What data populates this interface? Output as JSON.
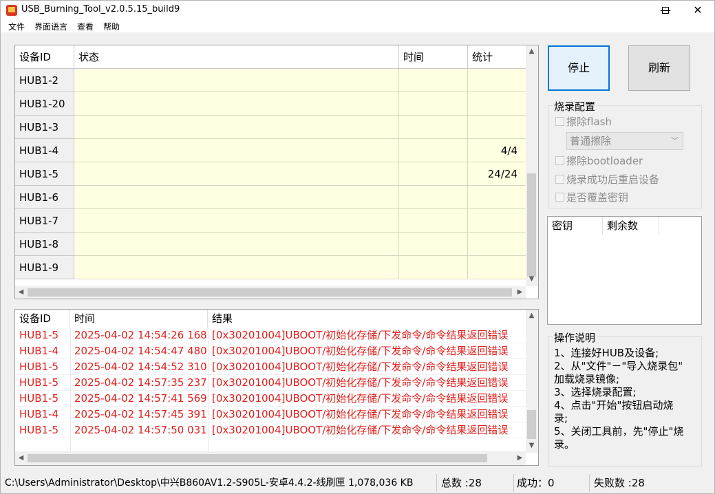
{
  "window": {
    "title": "USB_Burning_Tool_v2.0.5.15_build9"
  },
  "menu": [
    "文件",
    "界面语言",
    "查看",
    "帮助"
  ],
  "grid": {
    "headers": [
      "设备ID",
      "状态",
      "时间",
      "统计"
    ],
    "rows": [
      {
        "id": "HUB1-2",
        "status": "",
        "time": "",
        "stat": ""
      },
      {
        "id": "HUB1-20",
        "status": "",
        "time": "",
        "stat": ""
      },
      {
        "id": "HUB1-3",
        "status": "",
        "time": "",
        "stat": ""
      },
      {
        "id": "HUB1-4",
        "status": "",
        "time": "",
        "stat": "4/4"
      },
      {
        "id": "HUB1-5",
        "status": "",
        "time": "",
        "stat": "24/24"
      },
      {
        "id": "HUB1-6",
        "status": "",
        "time": "",
        "stat": ""
      },
      {
        "id": "HUB1-7",
        "status": "",
        "time": "",
        "stat": ""
      },
      {
        "id": "HUB1-8",
        "status": "",
        "time": "",
        "stat": ""
      },
      {
        "id": "HUB1-9",
        "status": "",
        "time": "",
        "stat": ""
      }
    ]
  },
  "log": {
    "headers": [
      "设备ID",
      "时间",
      "结果"
    ],
    "rows": [
      {
        "id": "HUB1-5",
        "time": "2025-04-02 14:54:26 168",
        "result": "[0x30201004]UBOOT/初始化存储/下发命令/命令结果返回错误"
      },
      {
        "id": "HUB1-4",
        "time": "2025-04-02 14:54:47 480",
        "result": "[0x30201004]UBOOT/初始化存储/下发命令/命令结果返回错误"
      },
      {
        "id": "HUB1-5",
        "time": "2025-04-02 14:54:52 310",
        "result": "[0x30201004]UBOOT/初始化存储/下发命令/命令结果返回错误"
      },
      {
        "id": "HUB1-5",
        "time": "2025-04-02 14:57:35 237",
        "result": "[0x30201004]UBOOT/初始化存储/下发命令/命令结果返回错误"
      },
      {
        "id": "HUB1-5",
        "time": "2025-04-02 14:57:41 569",
        "result": "[0x30201004]UBOOT/初始化存储/下发命令/命令结果返回错误"
      },
      {
        "id": "HUB1-4",
        "time": "2025-04-02 14:57:45 391",
        "result": "[0x30201004]UBOOT/初始化存储/下发命令/命令结果返回错误"
      },
      {
        "id": "HUB1-5",
        "time": "2025-04-02 14:57:50 031",
        "result": "[0x30201004]UBOOT/初始化存储/下发命令/命令结果返回错误"
      }
    ]
  },
  "buttons": {
    "stop": "停止",
    "refresh": "刷新"
  },
  "config": {
    "title": "烧录配置",
    "erase_flash": "擦除flash",
    "erase_mode": "普通擦除",
    "erase_bootloader": "擦除bootloader",
    "reboot_after": "烧录成功后重启设备",
    "overwrite_key": "是否覆盖密钥"
  },
  "keys": {
    "headers": [
      "密钥",
      "剩余数"
    ]
  },
  "instructions": {
    "title": "操作说明",
    "lines": [
      "1、连接好HUB及设备;",
      "2、从\"文件\"－\"导入烧录包\"",
      "加载烧录镜像;",
      "3、选择烧录配置;",
      "4、点击\"开始\"按钮启动烧",
      "录;",
      "5、关闭工具前，先\"停止\"烧",
      "录。"
    ]
  },
  "status": {
    "path": "C:\\Users\\Administrator\\Desktop\\中兴B860AV1.2-S905L-安卓4.4.2-线刷匣 1,078,036 KB",
    "total": "总数 :28",
    "success": "成功：0",
    "fail": "失败数 :28"
  }
}
